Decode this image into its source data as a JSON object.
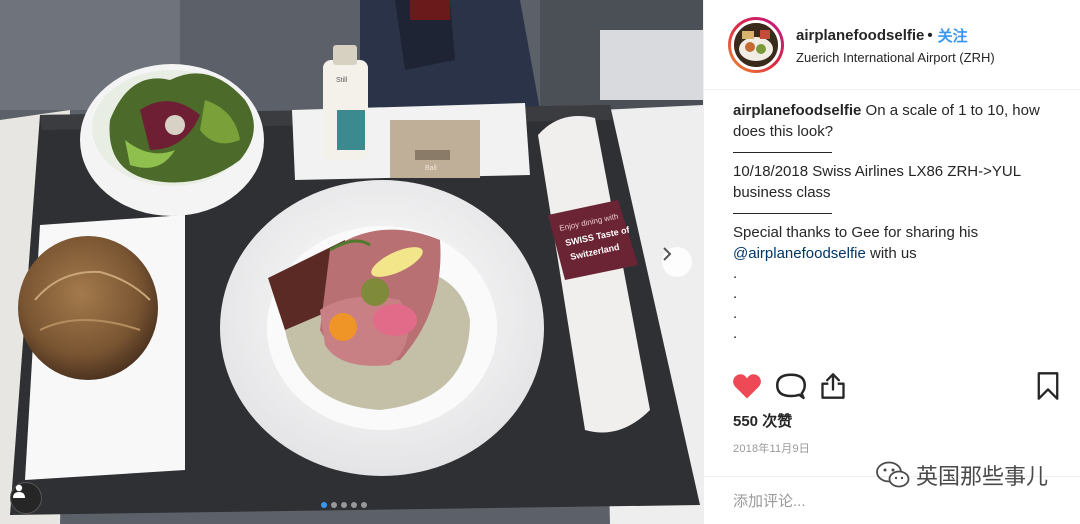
{
  "post": {
    "username": "airplanefoodselfie",
    "separator": "•",
    "follow_label": "关注",
    "location": "Zuerich International Airport (ZRH)",
    "caption": {
      "username": "airplanefoodselfie",
      "line1": "On a scale of 1 to 10, how does this look?",
      "line2": "10/18/2018 Swiss Airlines LX86 ZRH->YUL business class",
      "line3_prefix": "Special thanks to Gee for sharing his",
      "mention": "@airplanefoodselfie",
      "line3_suffix": " with us",
      "dots": [
        ".",
        ".",
        ".",
        "."
      ]
    },
    "likes_label": "550 次赞",
    "date": "2018年11月9日",
    "comment_placeholder": "添加评论..."
  },
  "photo": {
    "bottle_label": "Still",
    "card_label": "Ball",
    "napkin_band_line1": "Enjoy dining with",
    "napkin_band_line2": "SWISS Taste of",
    "napkin_band_line3": "Switzerland",
    "carousel_total": 5,
    "carousel_active": 0
  },
  "watermark": {
    "text": "英国那些事儿"
  },
  "colors": {
    "accent": "#3897f0",
    "like": "#ed4956",
    "text": "#262626",
    "muted": "#999999"
  },
  "icons": [
    "user-tag-icon",
    "next-arrow-icon",
    "heart-icon",
    "comment-icon",
    "share-icon",
    "bookmark-icon",
    "wechat-icon"
  ]
}
